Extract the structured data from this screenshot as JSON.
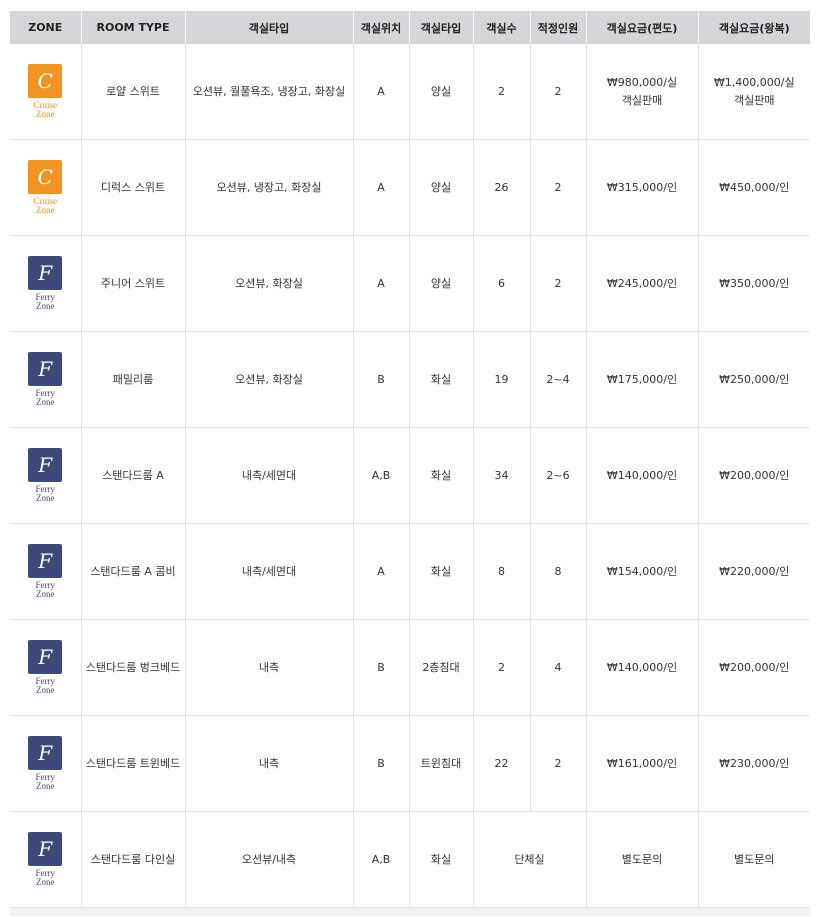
{
  "headers": [
    "ZONE",
    "ROOM TYPE",
    "객실타입",
    "객실위치",
    "객실타입",
    "객실수",
    "적정인원",
    "객실요금(편도)",
    "객실요금(왕복)"
  ],
  "zones": {
    "cruise": {
      "mark": "C",
      "line1": "Cruise",
      "line2": "Zone"
    },
    "ferry": {
      "mark": "F",
      "line1": "Ferry",
      "line2": "Zone"
    }
  },
  "rows": [
    {
      "zone": "cruise",
      "name": "로얄 스위트",
      "features": "오션뷰, 월풀욕조, 냉장고, 화장실",
      "location": "A",
      "type": "양실",
      "count": "2",
      "capacity": "2",
      "one_way": "₩980,000/실",
      "one_way_note": "객실판매",
      "round_trip": "₩1,400,000/실",
      "round_trip_note": "객실판매"
    },
    {
      "zone": "cruise",
      "name": "디럭스 스위트",
      "features": "오션뷰, 냉장고, 화장실",
      "location": "A",
      "type": "양실",
      "count": "26",
      "capacity": "2",
      "one_way": "₩315,000/인",
      "one_way_note": "",
      "round_trip": "₩450,000/인",
      "round_trip_note": ""
    },
    {
      "zone": "ferry",
      "name": "주니어 스위트",
      "features": "오션뷰, 화장실",
      "location": "A",
      "type": "양실",
      "count": "6",
      "capacity": "2",
      "one_way": "₩245,000/인",
      "one_way_note": "",
      "round_trip": "₩350,000/인",
      "round_trip_note": ""
    },
    {
      "zone": "ferry",
      "name": "패밀리룸",
      "features": "오션뷰, 화장실",
      "location": "B",
      "type": "화실",
      "count": "19",
      "capacity": "2~4",
      "one_way": "₩175,000/인",
      "one_way_note": "",
      "round_trip": "₩250,000/인",
      "round_trip_note": ""
    },
    {
      "zone": "ferry",
      "name": "스탠다드룸 A",
      "features": "내측/세면대",
      "location": "A,B",
      "type": "화실",
      "count": "34",
      "capacity": "2~6",
      "one_way": "₩140,000/인",
      "one_way_note": "",
      "round_trip": "₩200,000/인",
      "round_trip_note": ""
    },
    {
      "zone": "ferry",
      "name": "스탠다드룸 A 콤비",
      "features": "내측/세면대",
      "location": "A",
      "type": "화실",
      "count": "8",
      "capacity": "8",
      "one_way": "₩154,000/인",
      "one_way_note": "",
      "round_trip": "₩220,000/인",
      "round_trip_note": ""
    },
    {
      "zone": "ferry",
      "name": "스탠다드룸 벙크베드",
      "features": "내측",
      "location": "B",
      "type": "2층침대",
      "count": "2",
      "capacity": "4",
      "one_way": "₩140,000/인",
      "one_way_note": "",
      "round_trip": "₩200,000/인",
      "round_trip_note": ""
    },
    {
      "zone": "ferry",
      "name": "스탠다드룸 트윈베드",
      "features": "내측",
      "location": "B",
      "type": "트윈침대",
      "count": "22",
      "capacity": "2",
      "one_way": "₩161,000/인",
      "one_way_note": "",
      "round_trip": "₩230,000/인",
      "round_trip_note": ""
    }
  ],
  "last_row": {
    "zone": "ferry",
    "name": "스탠다드룸 다인실",
    "features": "오션뷰/내측",
    "location": "A,B",
    "type": "화실",
    "count_capacity": "단체실",
    "one_way": "별도문의",
    "round_trip": "별도문의"
  }
}
